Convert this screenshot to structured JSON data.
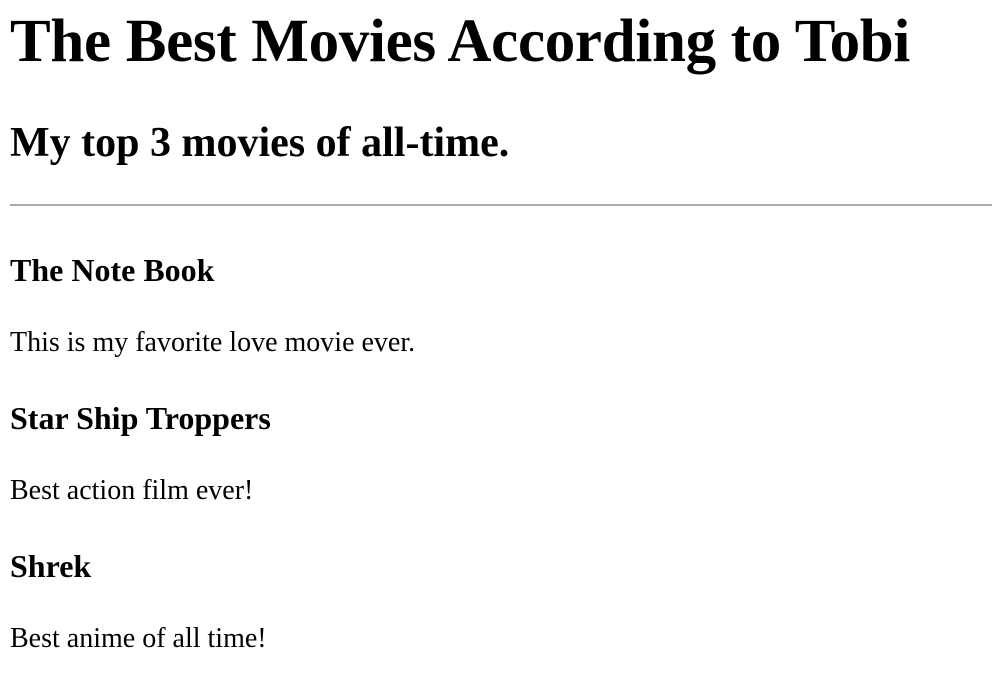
{
  "page": {
    "title": "The Best Movies According to Tobi",
    "subtitle": "My top 3 movies of all-time."
  },
  "movies": [
    {
      "title": "The Note Book",
      "description": "This is my favorite love movie ever."
    },
    {
      "title": "Star Ship Troppers",
      "description": "Best action film ever!"
    },
    {
      "title": "Shrek",
      "description": "Best anime of all time!"
    }
  ]
}
